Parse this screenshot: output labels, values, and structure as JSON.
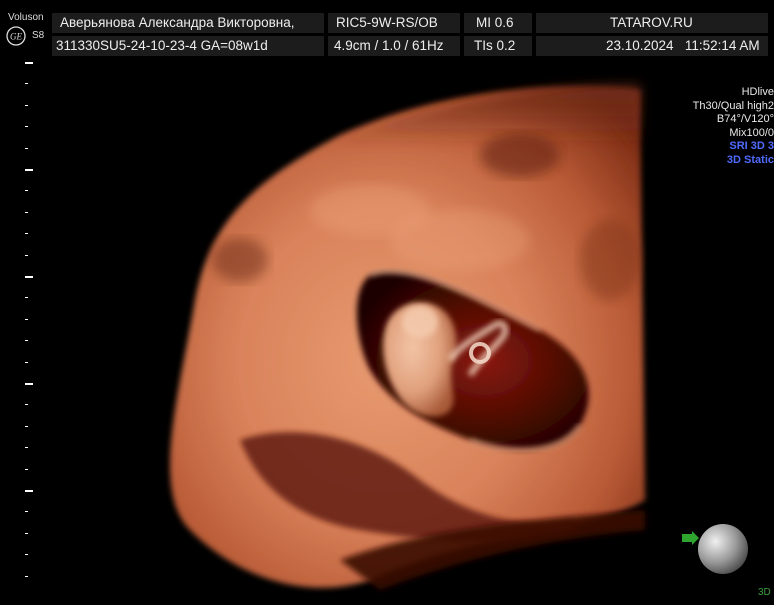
{
  "header": {
    "brand": "Voluson",
    "model": "S8",
    "patient_name": "Аверьянова Александра Викторовна,",
    "probe_preset": "RIC5-9W-RS/OB",
    "mi": "MI 0.6",
    "site": "TATAROV.RU",
    "exam_id": "311330SU5-24-10-23-4",
    "gest_age": "GA=08w1d",
    "depth_freq": "4.9cm / 1.0 / 61Hz",
    "tis": "TIs 0.2",
    "date": "23.10.2024",
    "time": "11:52:14 AM"
  },
  "info_panel": {
    "mode": "HDlive",
    "threshold_quality": "Th30/Qual high2",
    "angles": "B74°/V120°",
    "mix": "Mix100/0",
    "sri": "SRI 3D 3",
    "acquisition": "3D Static"
  },
  "corner_label": "3D",
  "colors": {
    "header_cell_bg": "#1c1c1c",
    "render_tissue": "#d9825a",
    "render_shadow": "#5a1408",
    "info_blue": "#4f6bff",
    "marker_green": "#2fa52f"
  },
  "icons": [
    "ge-logo-icon",
    "orientation-arrow-icon",
    "orientation-ball-icon"
  ]
}
